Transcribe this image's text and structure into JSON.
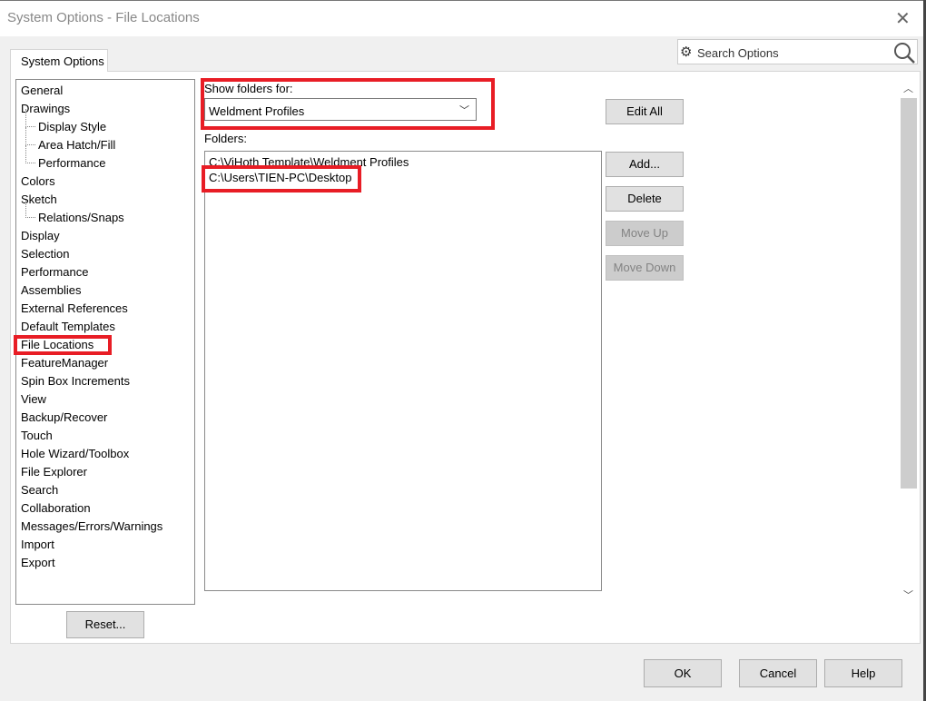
{
  "window": {
    "title": "System Options - File Locations"
  },
  "tab": "System Options",
  "search": {
    "placeholder": "Search Options"
  },
  "tree": [
    "General",
    "Drawings",
    "Display Style",
    "Area Hatch/Fill",
    "Performance",
    "Colors",
    "Sketch",
    "Relations/Snaps",
    "Display",
    "Selection",
    "Performance",
    "Assemblies",
    "External References",
    "Default Templates",
    "File Locations",
    "FeatureManager",
    "Spin Box Increments",
    "View",
    "Backup/Recover",
    "Touch",
    "Hole Wizard/Toolbox",
    "File Explorer",
    "Search",
    "Collaboration",
    "Messages/Errors/Warnings",
    "Import",
    "Export"
  ],
  "show_folders_label": "Show folders for:",
  "show_folders_value": "Weldment Profiles",
  "folders_label": "Folders:",
  "folders": [
    "C:\\ViHoth Template\\Weldment Profiles",
    "C:\\Users\\TIEN-PC\\Desktop"
  ],
  "buttons": {
    "edit_all": "Edit All",
    "add": "Add...",
    "delete": "Delete",
    "move_up": "Move Up",
    "move_down": "Move Down",
    "reset": "Reset...",
    "ok": "OK",
    "cancel": "Cancel",
    "help": "Help"
  },
  "annotation_color": "#e81d25"
}
